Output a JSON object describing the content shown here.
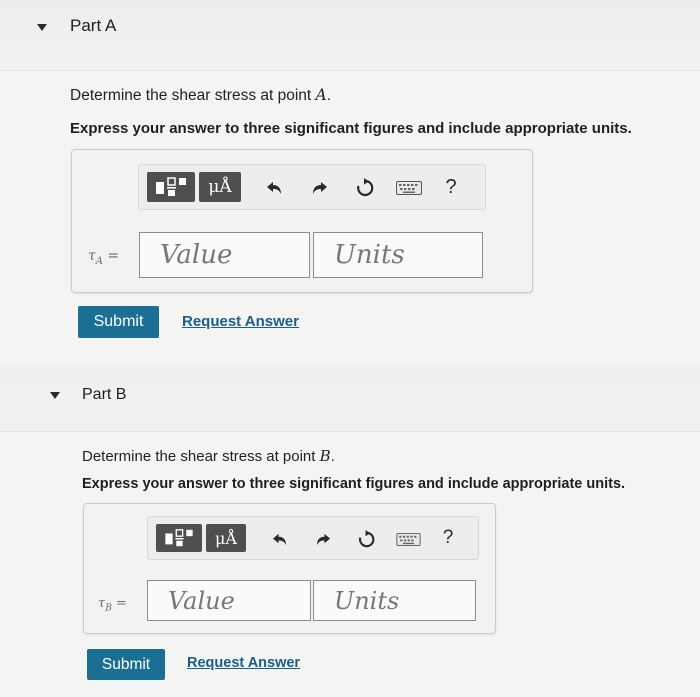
{
  "part_a": {
    "title": "Part A",
    "question_prefix": "Determine the shear stress at point ",
    "question_var": "A",
    "question_suffix": ".",
    "instruction": "Express your answer to three significant figures and include appropriate units.",
    "toolbar": {
      "units_button_label": "μÅ",
      "help_label": "?",
      "icons": [
        "templates-icon",
        "units-mu-angstrom-icon",
        "undo-icon",
        "redo-icon",
        "reset-icon",
        "keyboard-icon",
        "help-icon"
      ]
    },
    "lhs_symbol": "τ",
    "lhs_subscript": "A",
    "lhs_equals": " =",
    "value_placeholder": "Value",
    "units_placeholder": "Units",
    "submit_label": "Submit",
    "request_label": "Request Answer"
  },
  "part_b": {
    "title": "Part B",
    "question_prefix": "Determine the shear stress at point ",
    "question_var": "B",
    "question_suffix": ".",
    "instruction": "Express your answer to three significant figures and include appropriate units.",
    "toolbar": {
      "units_button_label": "μÅ",
      "help_label": "?",
      "icons": [
        "templates-icon",
        "units-mu-angstrom-icon",
        "undo-icon",
        "redo-icon",
        "reset-icon",
        "keyboard-icon",
        "help-icon"
      ]
    },
    "lhs_symbol": "τ",
    "lhs_subscript": "B",
    "lhs_equals": " =",
    "value_placeholder": "Value",
    "units_placeholder": "Units",
    "submit_label": "Submit",
    "request_label": "Request Answer"
  },
  "colors": {
    "submit_bg": "#1a6f93",
    "link": "#1a5f85",
    "toolbar_button_bg": "#4f4f4f"
  }
}
